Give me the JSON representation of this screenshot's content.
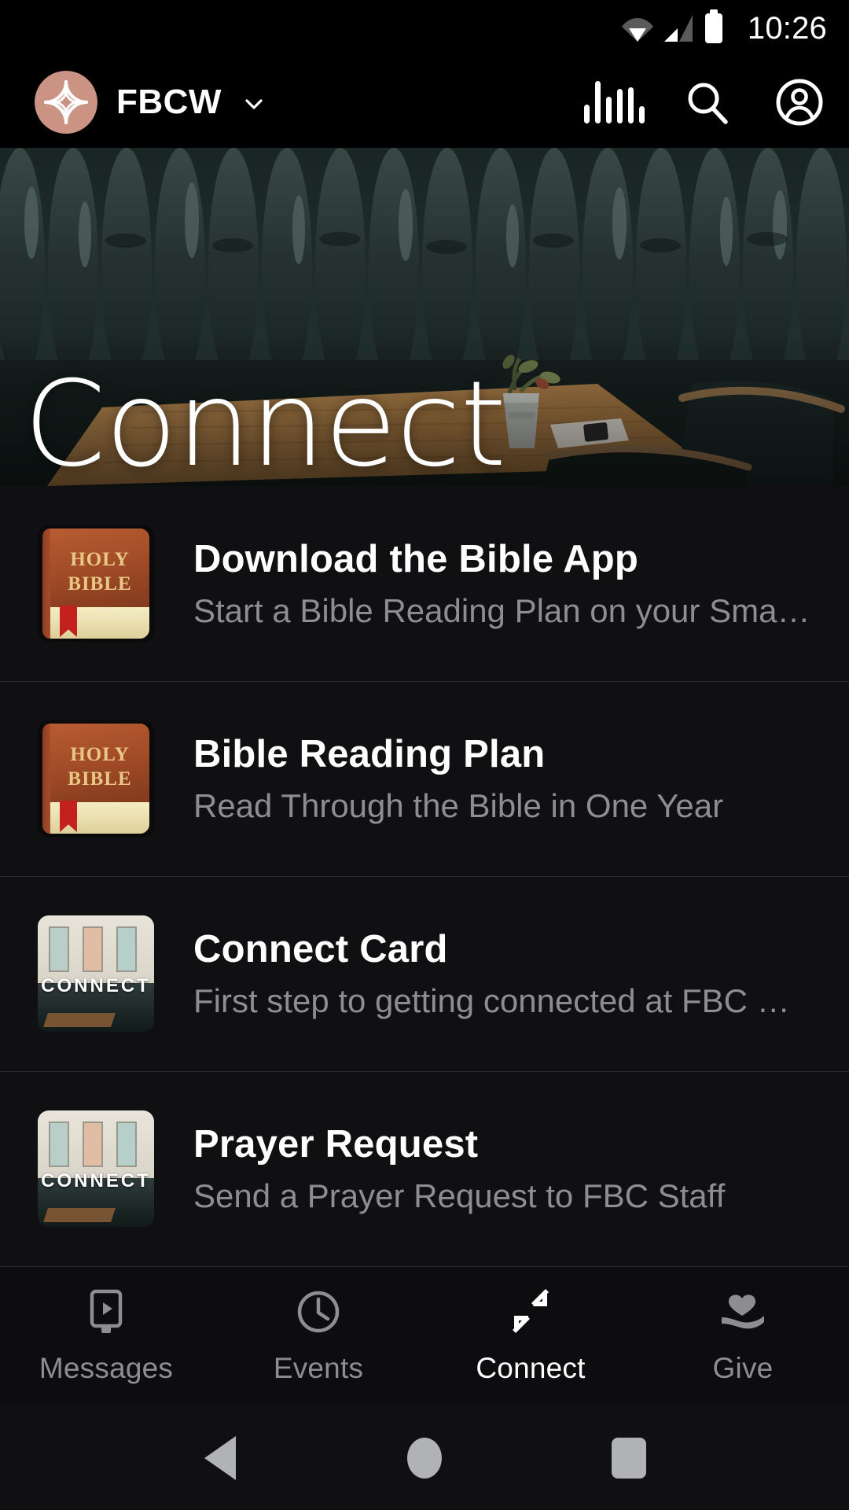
{
  "status_bar": {
    "time": "10:26",
    "icons": [
      "wifi-icon",
      "cellular-signal-icon",
      "battery-icon"
    ]
  },
  "app_bar": {
    "logo_icon": "fbcw-logo-icon",
    "brand_name": "FBCW",
    "dropdown_icon": "chevron-down-icon",
    "actions": [
      {
        "icon": "audio-waveform-icon",
        "name": "audio"
      },
      {
        "icon": "search-icon",
        "name": "search"
      },
      {
        "icon": "account-circle-icon",
        "name": "profile"
      }
    ]
  },
  "hero": {
    "title": "Connect",
    "image_alt": "dark green tufted leather booth with wooden table and potted plant"
  },
  "list": {
    "items": [
      {
        "thumb": "holy-bible-book-icon",
        "thumb_text_line1": "HOLY",
        "thumb_text_line2": "BIBLE",
        "title": "Download the Bible App",
        "subtitle": "Start a Bible Reading Plan on your Smart…"
      },
      {
        "thumb": "holy-bible-book-icon",
        "thumb_text_line1": "HOLY",
        "thumb_text_line2": "BIBLE",
        "title": "Bible Reading Plan",
        "subtitle": "Read Through the Bible in One Year"
      },
      {
        "thumb": "connect-room-photo",
        "thumb_word": "CONNECT",
        "title": "Connect Card",
        "subtitle": "First step to getting connected at FBC W…"
      },
      {
        "thumb": "connect-room-photo",
        "thumb_word": "CONNECT",
        "title": "Prayer Request",
        "subtitle": "Send a Prayer Request to FBC Staff"
      }
    ]
  },
  "tab_bar": {
    "active_index": 2,
    "tabs": [
      {
        "label": "Messages",
        "icon": "video-device-icon"
      },
      {
        "label": "Events",
        "icon": "clock-icon"
      },
      {
        "label": "Connect",
        "icon": "converging-arrows-icon"
      },
      {
        "label": "Give",
        "icon": "hand-heart-icon"
      }
    ]
  },
  "android_nav": {
    "buttons": [
      {
        "name": "back",
        "icon": "triangle-back-icon"
      },
      {
        "name": "home",
        "icon": "circle-home-icon"
      },
      {
        "name": "recents",
        "icon": "square-recents-icon"
      }
    ]
  },
  "colors": {
    "background": "#101012",
    "app_bar": "#000000",
    "brand_accent": "#cb9383",
    "divider": "#2a2a2c",
    "text_primary": "#ffffff",
    "text_secondary": "#8e8e90"
  }
}
